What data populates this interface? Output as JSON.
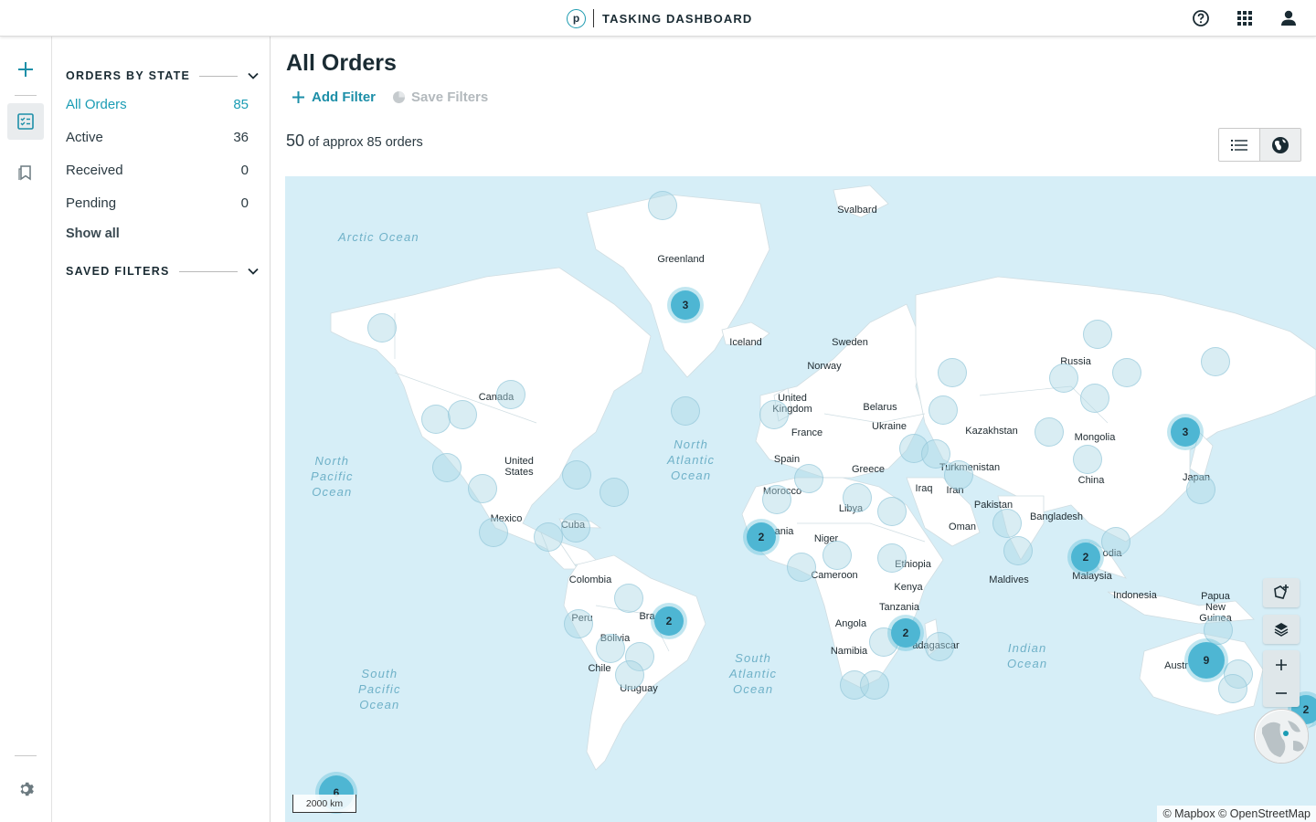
{
  "header": {
    "logo_letter": "p",
    "title": "TASKING DASHBOARD",
    "icons": [
      "help-icon",
      "apps-grid-icon",
      "user-icon"
    ]
  },
  "rail": {
    "items": [
      "add-icon",
      "orders-list-icon",
      "saved-icon"
    ],
    "bottom": "settings-icon"
  },
  "sidebar": {
    "orders_by_state": {
      "heading": "ORDERS BY STATE",
      "states": [
        {
          "label": "All Orders",
          "count": "85"
        },
        {
          "label": "Active",
          "count": "36"
        },
        {
          "label": "Received",
          "count": "0"
        },
        {
          "label": "Pending",
          "count": "0"
        }
      ],
      "show_all": "Show all"
    },
    "saved_filters": {
      "heading": "SAVED FILTERS"
    }
  },
  "main": {
    "title": "All Orders",
    "add_filter": "Add Filter",
    "save_filters": "Save Filters",
    "count_shown": "50",
    "count_text": "of approx 85 orders"
  },
  "map": {
    "oceans": {
      "arctic": "Arctic Ocean",
      "north_pacific": "North\nPacific\nOcean",
      "north_atlantic": "North\nAtlantic\nOcean",
      "south_atlantic": "South\nAtlantic\nOcean",
      "south_pacific": "South\nPacific\nOcean",
      "indian": "Indian\nOcean"
    },
    "places": {
      "svalbard": "Svalbard",
      "greenland": "Greenland",
      "iceland": "Iceland",
      "sweden": "Sweden",
      "norway": "Norway",
      "russia": "Russia",
      "canada": "Canada",
      "united_kingdom": "United\nKingdom",
      "belarus": "Belarus",
      "ukraine": "Ukraine",
      "france": "France",
      "kazakhstan": "Kazakhstan",
      "mongolia": "Mongolia",
      "united_states": "United\nStates",
      "spain": "Spain",
      "greece": "Greece",
      "turkmenistan": "Turkmenistan",
      "china": "China",
      "japan": "Japan",
      "morocco": "Morocco",
      "iraq": "Iraq",
      "iran": "Iran",
      "pakistan": "Pakistan",
      "mexico": "Mexico",
      "libya": "Libya",
      "cuba": "Cuba",
      "bangladesh": "Bangladesh",
      "mauritania": "ania",
      "oman": "Oman",
      "niger": "Niger",
      "cambodia": "odia",
      "ethiopia": "Ethiopia",
      "colombia": "Colombia",
      "cameroon": "Cameroon",
      "malaysia": "Malaysia",
      "maldives": "Maldives",
      "kenya": "Kenya",
      "indonesia": "Indonesia",
      "papua": "Papua\nNew\nGuinea",
      "tanzania": "Tanzania",
      "peru": "Peru",
      "brazil": "Bra",
      "angola": "Angola",
      "bolivia": "Bolivia",
      "madagascar": "adagascar",
      "namibia": "Namibia",
      "australia": "Austr",
      "chile": "Chile",
      "uruguay": "Uruguay"
    },
    "clusters": {
      "greenland": "3",
      "japan": "3",
      "mauritania": "2",
      "malaysia": "2",
      "brazil": "2",
      "madagascar": "2",
      "australia": "9",
      "east_edge": "2",
      "south_pacific": "6"
    },
    "scale": "2000 km",
    "attribution": "© Mapbox © OpenStreetMap"
  },
  "colors": {
    "accent": "#1b9cb4",
    "cluster": "#4eb6d3",
    "ocean": "#d6eef7",
    "land": "#ffffff"
  }
}
